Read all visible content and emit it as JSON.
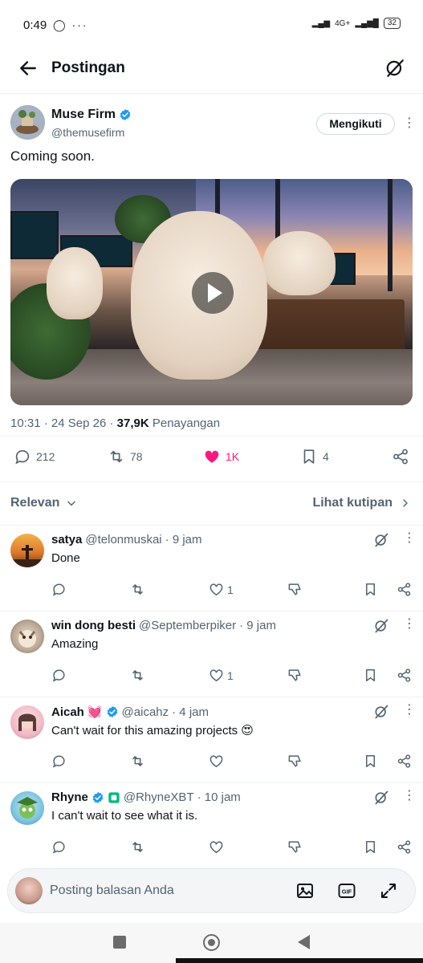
{
  "status_bar": {
    "time": "0:49",
    "left_icons": "◯ ···",
    "network": "4G+",
    "battery": "32"
  },
  "header": {
    "title": "Postingan"
  },
  "post": {
    "author_name": "Muse Firm",
    "author_handle": "@themusefirm",
    "follow_label": "Mengikuti",
    "text": "Coming soon.",
    "time": "10:31",
    "date": "24 Sep 26",
    "views_count": "37,9K",
    "views_label": "Penayangan",
    "stats": {
      "replies": "212",
      "reposts": "78",
      "likes": "1K",
      "bookmarks": "4"
    }
  },
  "sort": {
    "label": "Relevan",
    "quotes_label": "Lihat kutipan"
  },
  "replies": [
    {
      "name": "satya",
      "handle": "@telonmuskai",
      "time": "· 9 jam",
      "text": "Done",
      "likes": "1",
      "verified": false
    },
    {
      "name": "win dong besti",
      "handle": "@Septemberpiker",
      "time": "· 9 jam",
      "text": "Amazing",
      "likes": "1",
      "verified": false
    },
    {
      "name": "Aicah",
      "emoji": "💓",
      "handle": "@aicahz",
      "time": "· 4 jam",
      "text": "Can't wait for this amazing projects 😍",
      "likes": "",
      "verified": true
    },
    {
      "name": "Rhyne",
      "handle": "@RhyneXBT",
      "time": "· 10 jam",
      "text": "I can't wait to see what it is.",
      "likes": "",
      "verified": true
    }
  ],
  "composer": {
    "placeholder": "Posting balasan Anda"
  },
  "colors": {
    "like_pink": "#f91880",
    "verified_blue": "#1d9bf0",
    "secondary": "#536471"
  }
}
